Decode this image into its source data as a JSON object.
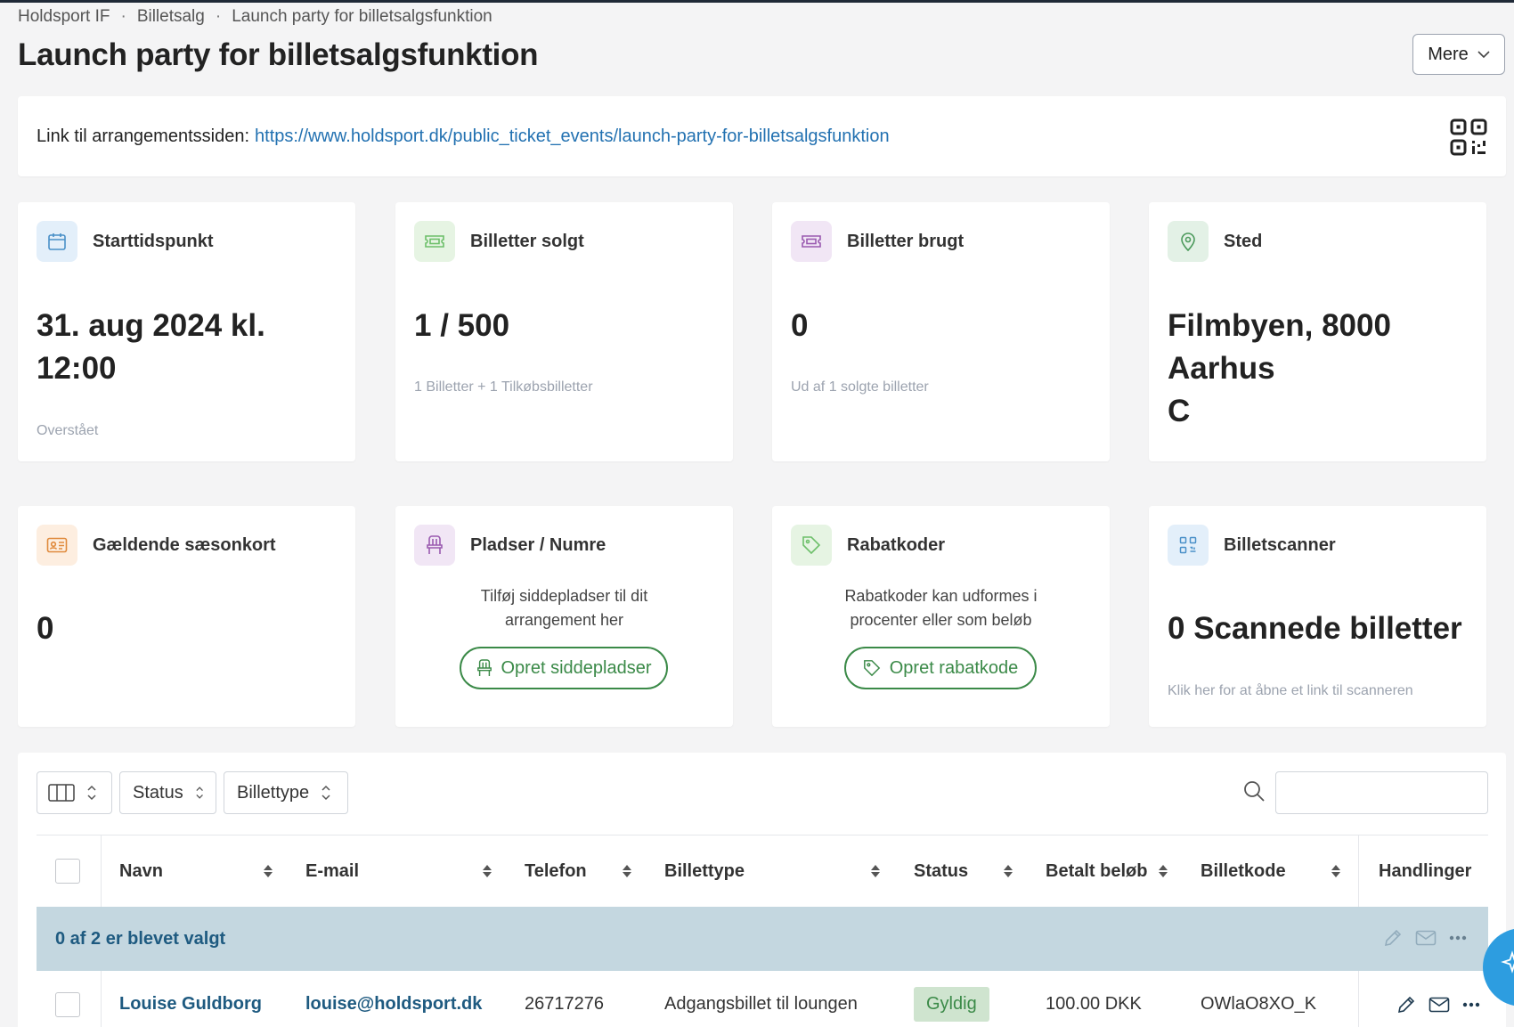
{
  "breadcrumb": {
    "items": [
      "Holdsport IF",
      "Billetsalg",
      "Launch party for billetsalgsfunktion"
    ],
    "separator": "·"
  },
  "page": {
    "title": "Launch party for billetsalgsfunktion",
    "more_button": "Mere"
  },
  "link_card": {
    "label": "Link til arrangementssiden:",
    "url": "https://www.holdsport.dk/public_ticket_events/launch-party-for-billetsalgsfunktion",
    "qr_icon": "qr-code-icon"
  },
  "stats": {
    "start": {
      "label": "Starttidspunkt",
      "value_line1": "31. aug 2024 kl.",
      "value_line2": "12:00",
      "sub": "Overstået",
      "icon": "calendar-icon",
      "icon_bg": "#e3effa",
      "icon_color": "#4a90c8"
    },
    "sold": {
      "label": "Billetter solgt",
      "value": "1 / 500",
      "sub": "1 Billetter + 1 Tilkøbsbilletter",
      "icon": "ticket-icon",
      "icon_bg": "#e6f4e3",
      "icon_color": "#6dbf6a"
    },
    "used": {
      "label": "Billetter brugt",
      "value": "0",
      "sub": "Ud af 1 solgte billetter",
      "icon": "ticket-icon",
      "icon_bg": "#f1e6f5",
      "icon_color": "#9a5ab0"
    },
    "place": {
      "label": "Sted",
      "value_line1": "Filmbyen, 8000 Aarhus",
      "value_line2": "C",
      "icon": "map-pin-icon",
      "icon_bg": "#e3f1e6",
      "icon_color": "#4c9a5c"
    },
    "season": {
      "label": "Gældende sæsonkort",
      "value": "0",
      "icon": "id-card-icon",
      "icon_bg": "#fdeee0",
      "icon_color": "#e08a3c"
    },
    "seats": {
      "label": "Pladser / Numre",
      "desc_line1": "Tilføj siddepladser til dit",
      "desc_line2": "arrangement her",
      "button": "Opret siddepladser",
      "icon": "chair-icon",
      "icon_bg": "#f1e6f5",
      "icon_color": "#9a5ab0"
    },
    "discount": {
      "label": "Rabatkoder",
      "desc_line1": "Rabatkoder kan udformes i",
      "desc_line2": "procenter eller som beløb",
      "button": "Opret rabatkode",
      "icon": "tag-icon",
      "icon_bg": "#e6f4e3",
      "icon_color": "#6dbf6a"
    },
    "scanner": {
      "label": "Billetscanner",
      "value": "0 Scannede billetter",
      "sub": "Klik her for at åbne et link til scanneren",
      "icon": "qr-code-icon",
      "icon_bg": "#e3effa",
      "icon_color": "#4a90c8"
    }
  },
  "table": {
    "toolbar": {
      "columns_icon": "columns-icon",
      "status_filter": "Status",
      "tickettype_filter": "Billettype",
      "search_placeholder": ""
    },
    "columns": [
      "Navn",
      "E-mail",
      "Telefon",
      "Billettype",
      "Status",
      "Betalt beløb",
      "Billetkode",
      "Handlinger"
    ],
    "selection_text": "0 af 2 er blevet valgt",
    "rows": [
      {
        "name": "Louise Guldborg",
        "email": "louise@holdsport.dk",
        "phone": "26717276",
        "ticket_type": "Adgangsbillet til loungen",
        "status": "Gyldig",
        "amount": "100.00 DKK",
        "code": "OWlaO8XO_K"
      }
    ]
  },
  "colors": {
    "link": "#2271b1",
    "accent_green": "#3b8a48",
    "selection_bg": "#c4d7e0",
    "fab": "#2d9de0"
  }
}
